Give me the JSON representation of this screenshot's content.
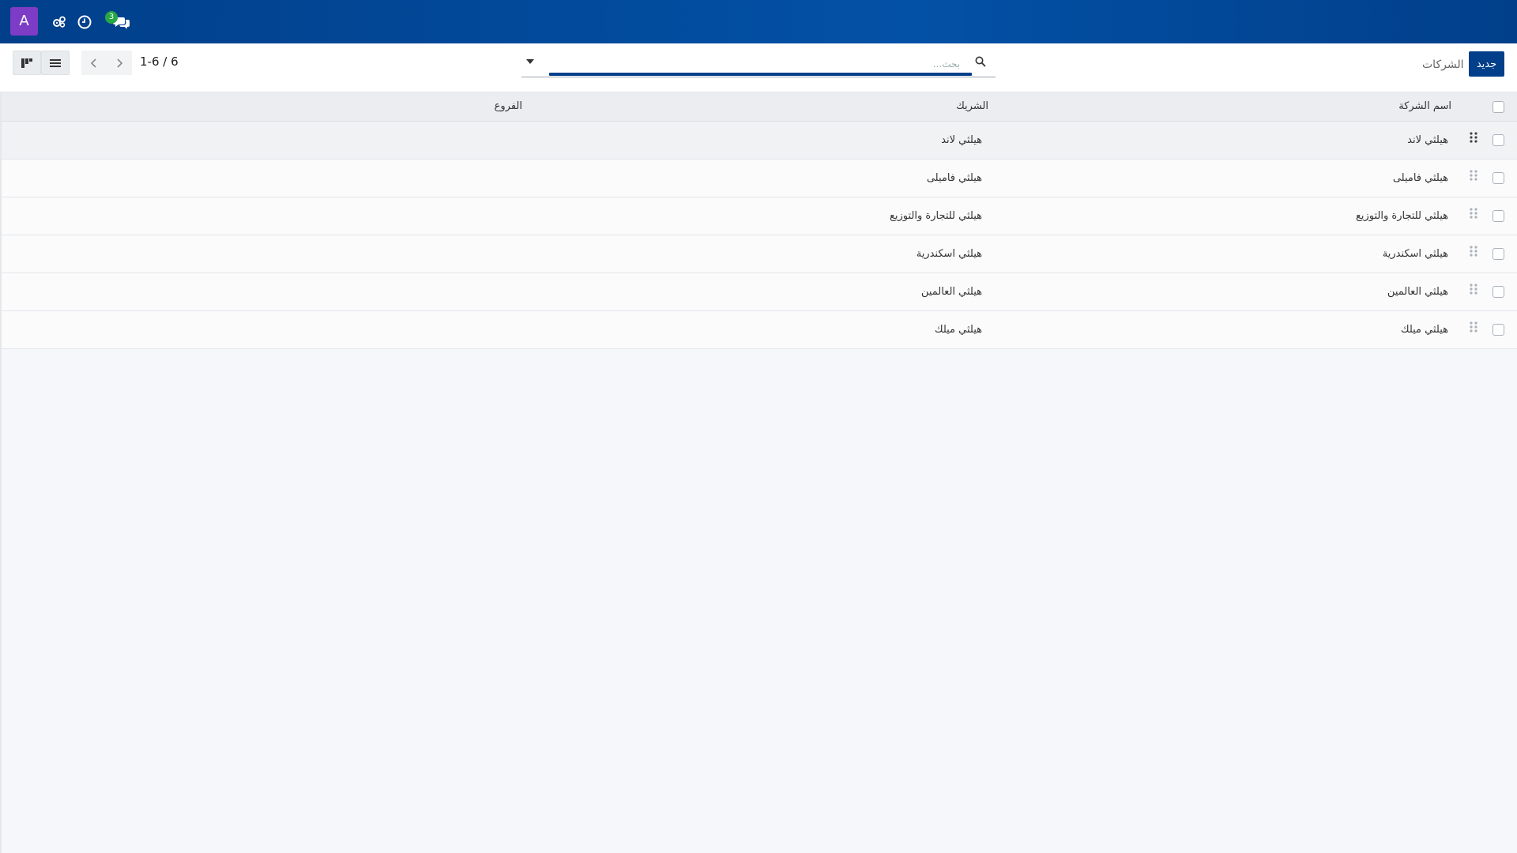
{
  "navbar": {
    "avatar_letter": "A",
    "messages_count": "3",
    "icons": [
      "settings-gears-icon",
      "activity-clock-icon",
      "chat-messages-icon"
    ],
    "background": "#013f8a"
  },
  "control_panel": {
    "breadcrumb": "الشركات",
    "new_button": "جديد",
    "search_placeholder": "بحث...",
    "pager_value": "1-6 / 6",
    "views": [
      "kanban-view-icon",
      "list-view-icon"
    ]
  },
  "table": {
    "columns": {
      "company_name": "اسم الشركة",
      "partner": "الشريك",
      "branches": "الفروع"
    },
    "rows": [
      {
        "company_name": "هيلثي لاند",
        "partner": "هيلثي لاند",
        "branches": ""
      },
      {
        "company_name": "هيلثي فاميلى",
        "partner": "هيلثي فاميلى",
        "branches": ""
      },
      {
        "company_name": "هيلثي للتجارة والتوزيع",
        "partner": "هيلثي للتجارة والتوزيع",
        "branches": ""
      },
      {
        "company_name": "هيلثي اسكندرية",
        "partner": "هيلثي اسكندرية",
        "branches": ""
      },
      {
        "company_name": "هيلثي العالمين",
        "partner": "هيلثي العالمين",
        "branches": ""
      },
      {
        "company_name": "هيلثي ميلك",
        "partner": "هيلثي ميلك",
        "branches": ""
      }
    ]
  },
  "colors": {
    "primary": "#013f8a",
    "avatar": "#7d3cc5",
    "badge": "#28a745"
  }
}
